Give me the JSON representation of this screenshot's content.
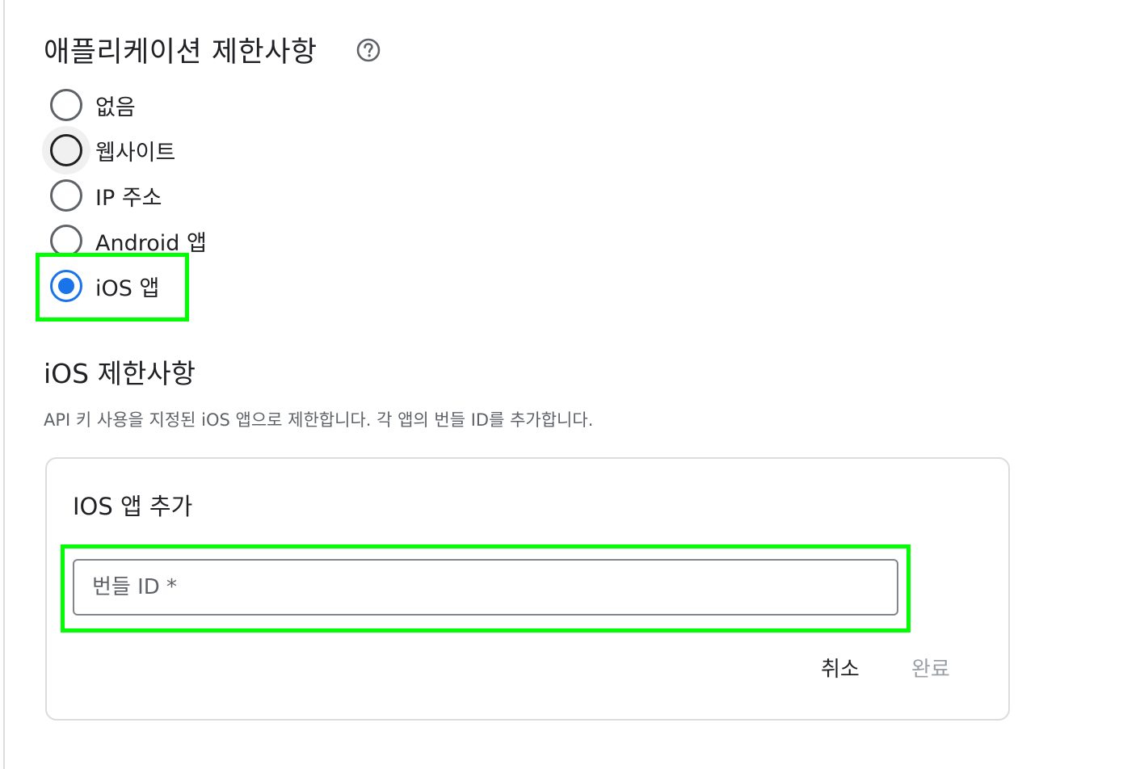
{
  "section": {
    "title": "애플리케이션 제한사항",
    "help_icon": "help-circle-icon"
  },
  "restrictions": {
    "options": [
      {
        "label": "없음",
        "state": "unchecked"
      },
      {
        "label": "웹사이트",
        "state": "focused"
      },
      {
        "label": "IP 주소",
        "state": "unchecked"
      },
      {
        "label": "Android 앱",
        "state": "unchecked"
      },
      {
        "label": "iOS 앱",
        "state": "checked"
      }
    ]
  },
  "ios": {
    "title": "iOS 제한사항",
    "description": "API 키 사용을 지정된 iOS 앱으로 제한합니다. 각 앱의 번들 ID를 추가합니다."
  },
  "add_app": {
    "title": "IOS 앱 추가",
    "bundle_id_placeholder": "번들 ID *",
    "bundle_id_value": "",
    "cancel_label": "취소",
    "done_label": "완료"
  },
  "colors": {
    "accent": "#1a73e8",
    "highlight": "#00ff00",
    "disabled_text": "#9aa0a6"
  }
}
